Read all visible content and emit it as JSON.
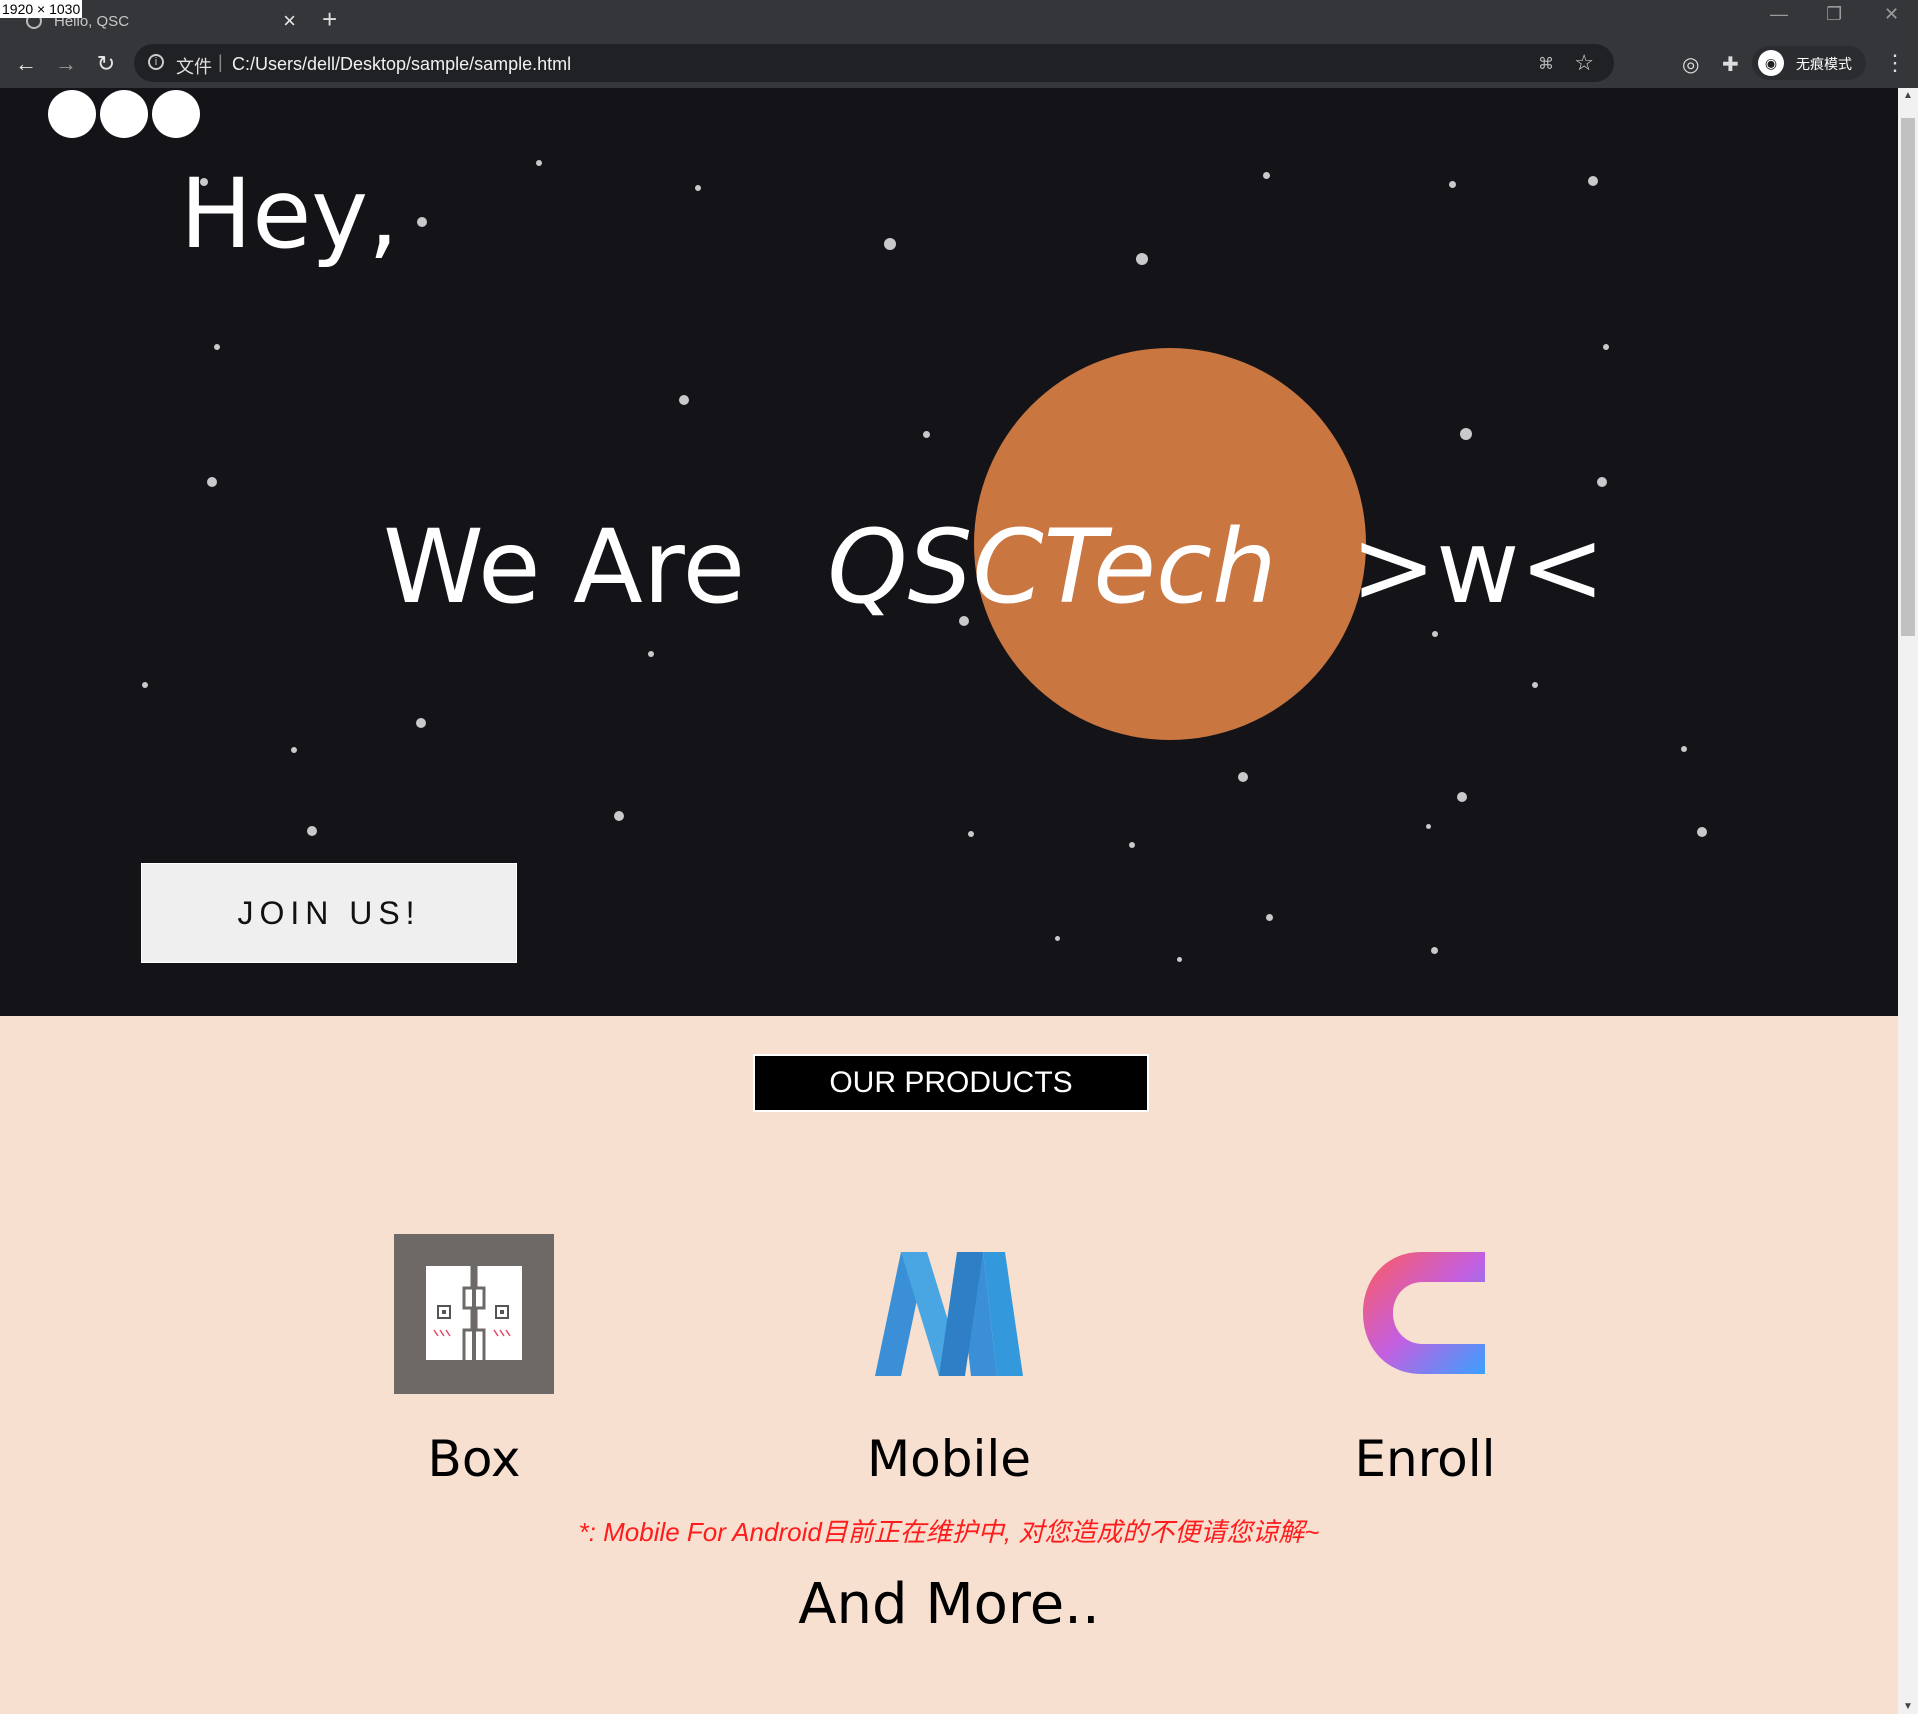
{
  "dimension_badge": "1920 × 1030",
  "browser": {
    "tab_title": "Hello, QSC",
    "tab_close": "×",
    "new_tab": "+",
    "window_controls": [
      "—",
      "❐",
      "✕"
    ],
    "back": "←",
    "forward": "→",
    "reload": "↻",
    "address_scheme": "文件",
    "address_sep": "|",
    "url": "C:/Users/dell/Desktop/sample/sample.html",
    "incognito_label": "无痕模式",
    "menu": "⋮"
  },
  "hero": {
    "greeting": "Hey,",
    "headline_prefix": "We Are",
    "headline_brand": "QSCTech",
    "headline_face": ">w<",
    "join_label": "JOIN US!",
    "background": "#141318",
    "planet_color": "#c97641"
  },
  "products": {
    "title": "OUR PRODUCTS",
    "items": [
      {
        "label": "Box",
        "icon": "box-app-icon"
      },
      {
        "label": "Mobile",
        "icon": "mobile-m-icon"
      },
      {
        "label": "Enroll",
        "icon": "enroll-c-icon"
      }
    ],
    "note": "*: Mobile For Android目前正在维护中, 对您造成的不便请您谅解~",
    "more": "And More..",
    "background": "#f8e0d0",
    "note_color": "#ff1c1c"
  }
}
